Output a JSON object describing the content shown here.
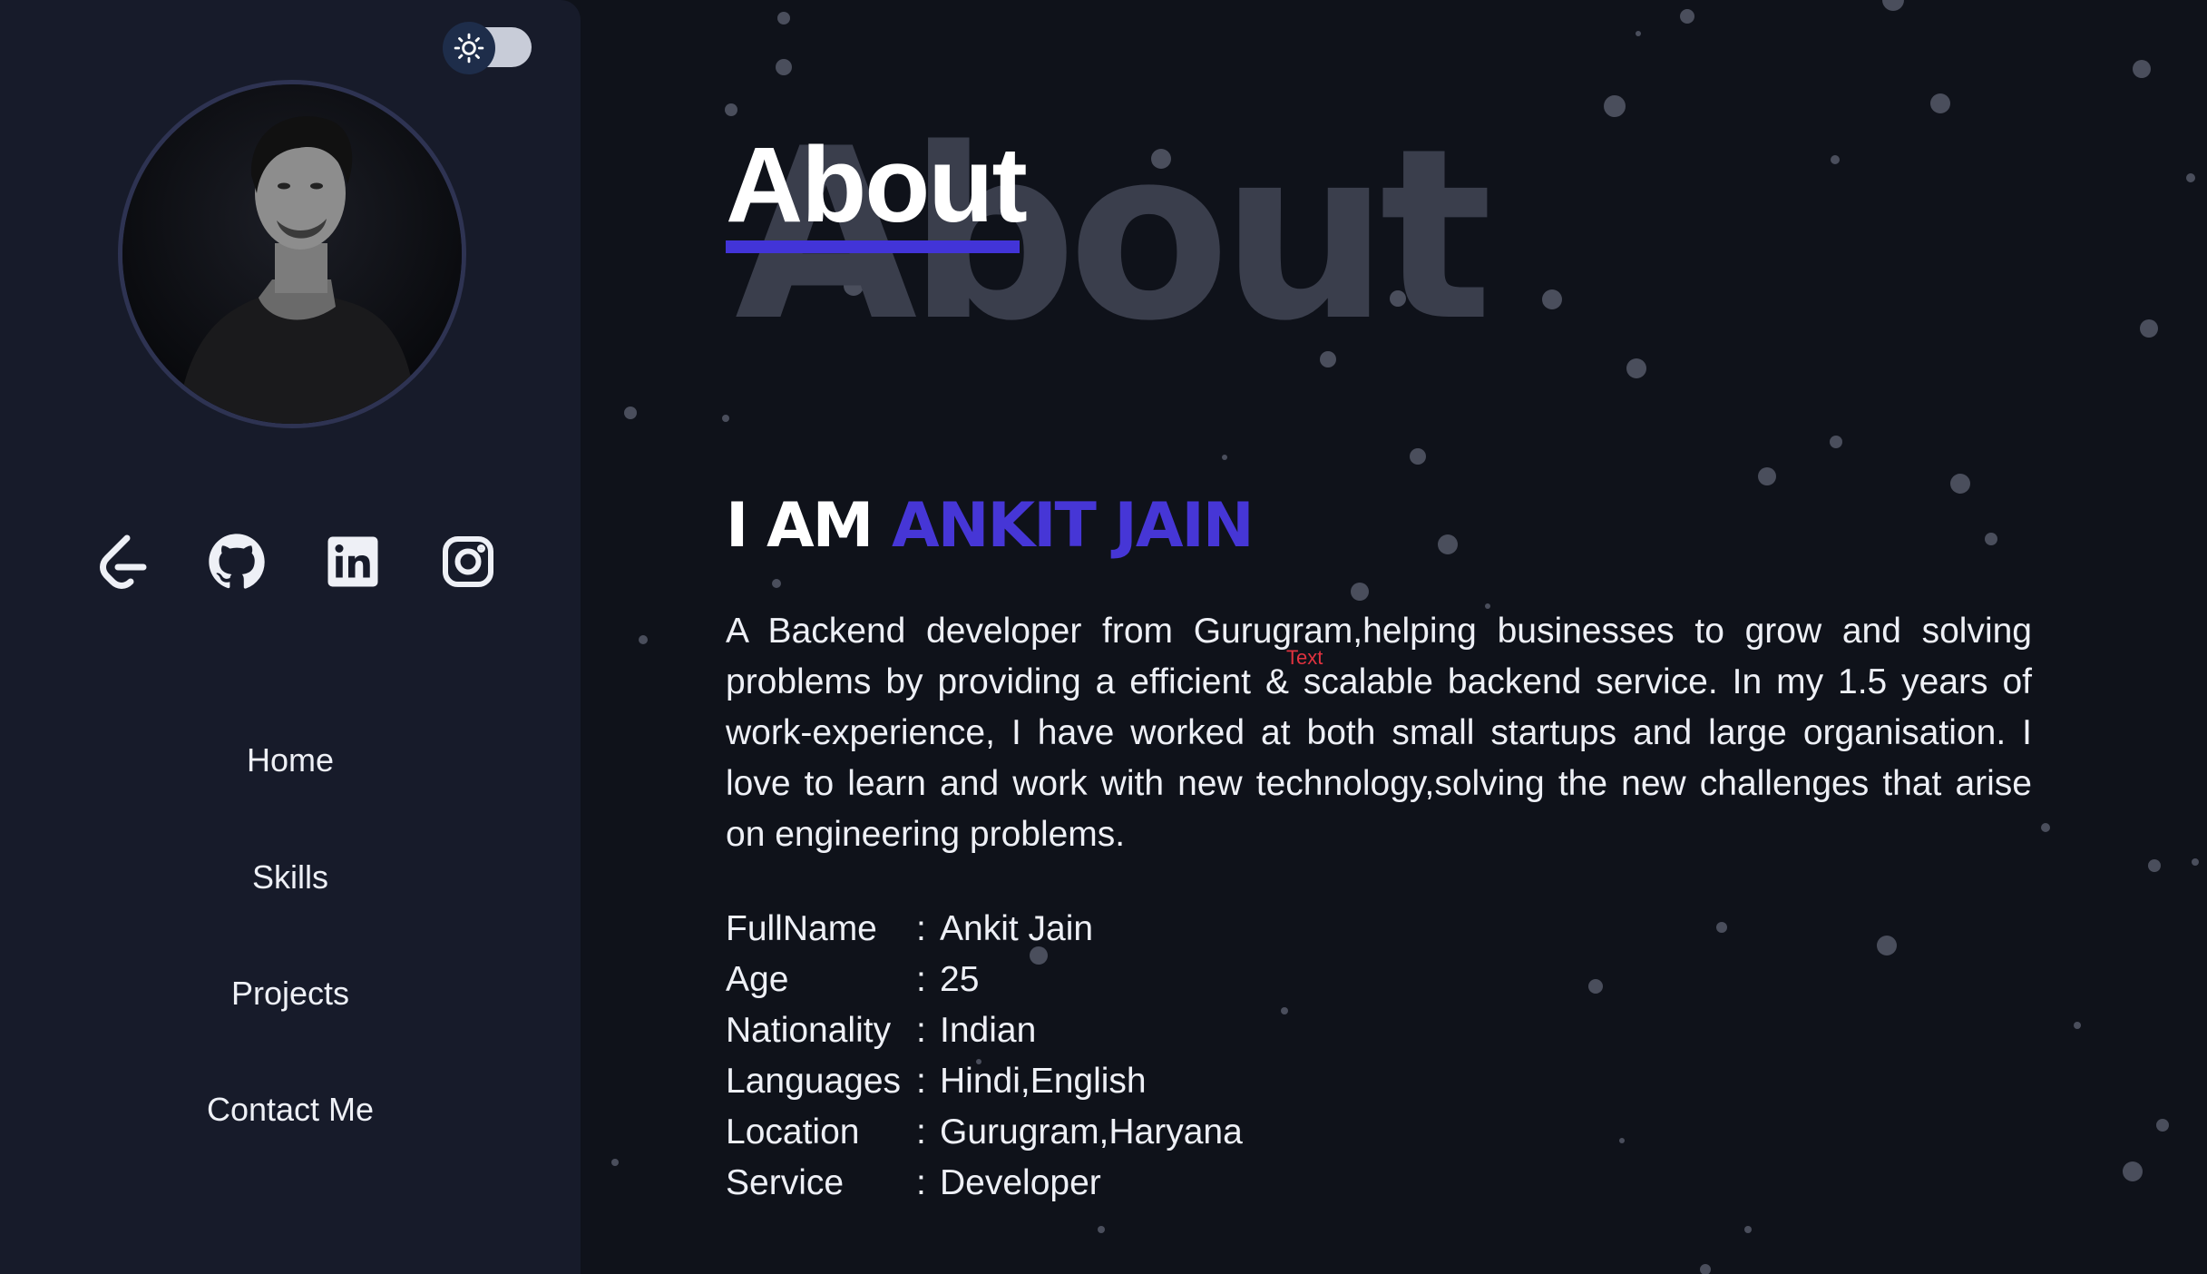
{
  "theme_toggle": {
    "icon": "sun-icon",
    "state": "dark"
  },
  "social": [
    {
      "name": "leetcode-icon"
    },
    {
      "name": "github-icon"
    },
    {
      "name": "linkedin-icon"
    },
    {
      "name": "instagram-icon"
    }
  ],
  "nav": {
    "home": "Home",
    "skills": "Skills",
    "projects": "Projects",
    "contact": "Contact Me"
  },
  "about": {
    "bg_word": "About",
    "title": "About",
    "iam_prefix": "I AM",
    "iam_name": "ANKIT JAIN",
    "bio": "A Backend developer from Gurugram,helping businesses to grow and solving problems by providing a efficient & scalable backend service. In my 1.5 years of work-experience, I have worked at both small startups and large organisation. I love to learn and work with new technology,solving the new challenges that arise on engineering problems.",
    "overlay_text": "Text"
  },
  "details": [
    {
      "label": "FullName",
      "value": "Ankit Jain"
    },
    {
      "label": "Age",
      "value": "25"
    },
    {
      "label": "Nationality",
      "value": "Indian"
    },
    {
      "label": "Languages",
      "value": "Hindi,English"
    },
    {
      "label": "Location",
      "value": "Gurugram,Haryana"
    },
    {
      "label": "Service",
      "value": "Developer"
    }
  ],
  "separator": ":",
  "colors": {
    "accent": "#4636d6",
    "sidebar": "#171b2a",
    "background": "#0f121a"
  }
}
